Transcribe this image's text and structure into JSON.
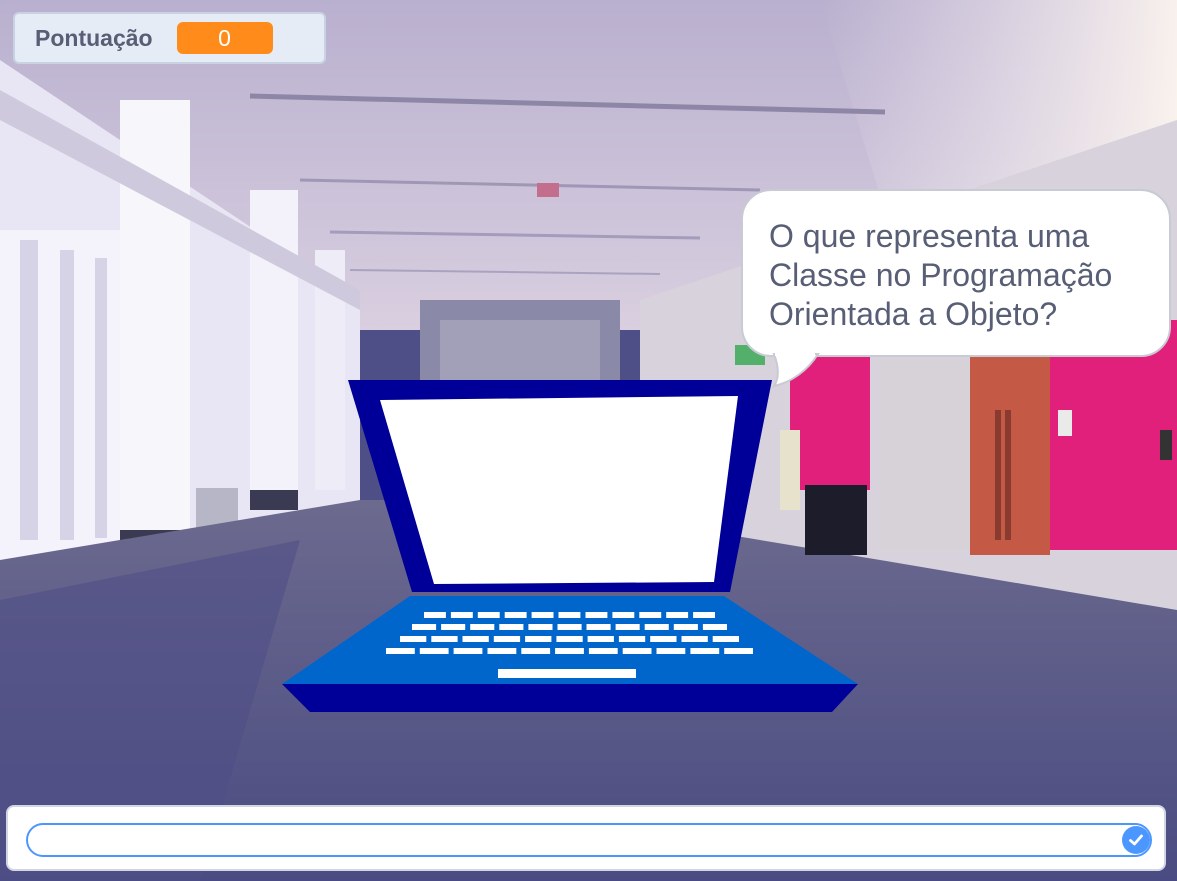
{
  "score_monitor": {
    "label": "Pontuação",
    "value": "0"
  },
  "speech_bubble": {
    "text": "O que representa uma Classe no Programação Orientada a Objeto?"
  },
  "ask": {
    "value": "",
    "submit_icon": "checkmark-icon"
  },
  "sprite": {
    "name_icon": "laptop-icon"
  },
  "colors": {
    "monitor_value_bg": "#ff8c1a",
    "accent_blue": "#4c97ff",
    "laptop_frame": "#000099",
    "laptop_base": "#0066cc",
    "wall_magenta": "#e0207a"
  }
}
